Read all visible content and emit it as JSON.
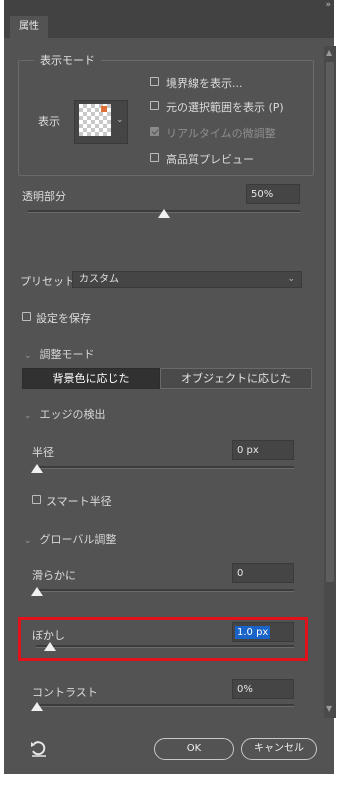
{
  "tab": {
    "label": "属性"
  },
  "top_right_glyph": "»",
  "display_mode": {
    "legend": "表示モード",
    "view_label": "表示",
    "options": [
      {
        "label": "境界線を表示...",
        "checked": false,
        "enabled": true
      },
      {
        "label": "元の選択範囲を表示 (P)",
        "checked": false,
        "enabled": true
      },
      {
        "label": "リアルタイムの微調整",
        "checked": true,
        "enabled": false
      },
      {
        "label": "高品質プレビュー",
        "checked": false,
        "enabled": true
      }
    ]
  },
  "opacity": {
    "label": "透明部分",
    "value": "50%",
    "level": 0.5
  },
  "preset": {
    "label": "プリセット",
    "selected": "カスタム"
  },
  "save_settings": {
    "label": "設定を保存",
    "checked": false
  },
  "adjust_mode": {
    "header": "調整モード",
    "segments": [
      {
        "label": "背景色に応じた",
        "active": true
      },
      {
        "label": "オブジェクトに応じた",
        "active": false
      }
    ]
  },
  "edge_detection": {
    "header": "エッジの検出",
    "radius": {
      "label": "半径",
      "value": "0 px",
      "level": 0.0
    },
    "smart_radius": {
      "label": "スマート半径",
      "checked": false
    }
  },
  "global_refinement": {
    "header": "グローバル調整",
    "smooth": {
      "label": "滑らかに",
      "value": "0",
      "level": 0.0
    },
    "feather": {
      "label": "ぼかし",
      "value": "1.0 px",
      "level": 0.05
    },
    "contrast": {
      "label": "コントラスト",
      "value": "0%",
      "level": 0.0
    }
  },
  "buttons": {
    "ok": "OK",
    "cancel": "キャンセル"
  },
  "colors": {
    "panel": "#535353",
    "highlight": "#e2121a",
    "selection": "#1a63c8"
  }
}
